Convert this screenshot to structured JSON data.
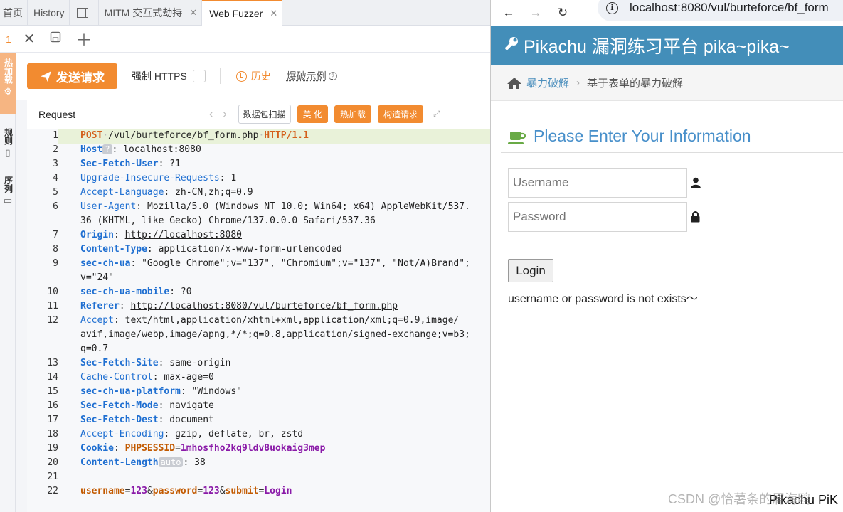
{
  "app": {
    "tabs": [
      {
        "label": "首页"
      },
      {
        "label": "History"
      },
      {
        "label": "MITM 交互式劫持"
      },
      {
        "label": "Web Fuzzer"
      }
    ],
    "subtab_index": "1",
    "sidebar": [
      {
        "label": "热加载"
      },
      {
        "label": "规则"
      },
      {
        "label": "序列"
      }
    ],
    "toolbar": {
      "send_label": "发送请求",
      "https_label": "强制 HTTPS",
      "history_label": "历史",
      "example_label": "爆破示例"
    },
    "request_panel": {
      "title": "Request",
      "scan_label": "数据包扫描",
      "beautify_label": "美 化",
      "hotload_label": "热加载",
      "construct_label": "构造请求"
    },
    "request": {
      "method": "POST",
      "path": "/vul/burteforce/bf_form.php",
      "version": "HTTP/1.1",
      "headers": [
        {
          "n": "2",
          "name": "Host",
          "value": "localhost:8080",
          "badge": "?"
        },
        {
          "n": "3",
          "name": "Sec-Fetch-User",
          "value": "?1"
        },
        {
          "n": "4",
          "name": "Upgrade-Insecure-Requests",
          "value": "1"
        },
        {
          "n": "5",
          "name": "Accept-Language",
          "value": "zh-CN,zh;q=0.9"
        },
        {
          "n": "6",
          "name": "User-Agent",
          "value": "Mozilla/5.0 (Windows NT 10.0; Win64; x64) AppleWebKit/537.36 (KHTML, like Gecko) Chrome/137.0.0.0 Safari/537.36"
        },
        {
          "n": "7",
          "name": "Origin",
          "value": "http://localhost:8080"
        },
        {
          "n": "8",
          "name": "Content-Type",
          "value": "application/x-www-form-urlencoded"
        },
        {
          "n": "9",
          "name": "sec-ch-ua",
          "value": "\"Google Chrome\";v=\"137\", \"Chromium\";v=\"137\", \"Not/A)Brand\";v=\"24\""
        },
        {
          "n": "10",
          "name": "sec-ch-ua-mobile",
          "value": "?0"
        },
        {
          "n": "11",
          "name": "Referer",
          "value": "http://localhost:8080/vul/burteforce/bf_form.php"
        },
        {
          "n": "12",
          "name": "Accept",
          "value": "text/html,application/xhtml+xml,application/xml;q=0.9,image/avif,image/webp,image/apng,*/*;q=0.8,application/signed-exchange;v=b3;q=0.7"
        },
        {
          "n": "13",
          "name": "Sec-Fetch-Site",
          "value": "same-origin"
        },
        {
          "n": "14",
          "name": "Cache-Control",
          "value": "max-age=0"
        },
        {
          "n": "15",
          "name": "sec-ch-ua-platform",
          "value": "\"Windows\""
        },
        {
          "n": "16",
          "name": "Sec-Fetch-Mode",
          "value": "navigate"
        },
        {
          "n": "17",
          "name": "Sec-Fetch-Dest",
          "value": "document"
        },
        {
          "n": "18",
          "name": "Accept-Encoding",
          "value": "gzip, deflate, br, zstd"
        },
        {
          "n": "19",
          "name": "Cookie",
          "value": "PHPSESSID=1mhosfho2kq9ldv8uokaig3mep"
        },
        {
          "n": "20",
          "name": "Content-Length",
          "value": "38",
          "badge": "auto"
        }
      ],
      "body": "username=123&password=123&submit=Login"
    }
  },
  "browser": {
    "url": "localhost:8080/vul/burteforce/bf_form",
    "site_title": "Pikachu 漏洞练习平台 pika~pika~",
    "breadcrumb": {
      "parent": "暴力破解",
      "current": "基于表单的暴力破解"
    },
    "form_title": "Please Enter Your Information",
    "username_placeholder": "Username",
    "password_placeholder": "Password",
    "login_label": "Login",
    "message": "username or password is not exists～",
    "footer": "Pikachu PiK"
  },
  "watermark": "CSDN @恰薯条的屑海鸥",
  "colors": {
    "accent": "#f28b30",
    "pikachu_blue": "#438eb9",
    "link": "#4c8fbd"
  }
}
